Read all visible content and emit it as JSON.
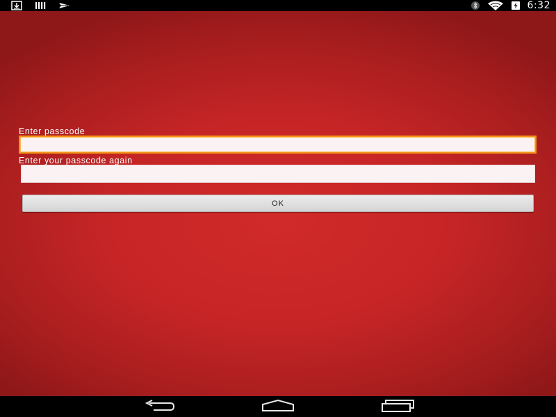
{
  "status_bar": {
    "left_icons": [
      "download-notification-icon",
      "signal-bars-notification-icon",
      "send-notification-icon"
    ],
    "right_icons": [
      "bluetooth-icon",
      "wifi-icon",
      "battery-charging-icon"
    ],
    "time": "6:32"
  },
  "form": {
    "passcode_label": "Enter passcode",
    "passcode_value": "",
    "passcode_placeholder": "",
    "confirm_label": "Enter your passcode again",
    "confirm_value": "",
    "confirm_placeholder": "",
    "ok_label": "OK"
  },
  "nav_bar": {
    "buttons": [
      "back-icon",
      "home-icon",
      "recents-icon"
    ]
  },
  "colors": {
    "background_red": "#c62526",
    "focus_outline": "#f29318",
    "input_bg": "#fbf3f3",
    "button_bg": "#e0e0e0"
  }
}
